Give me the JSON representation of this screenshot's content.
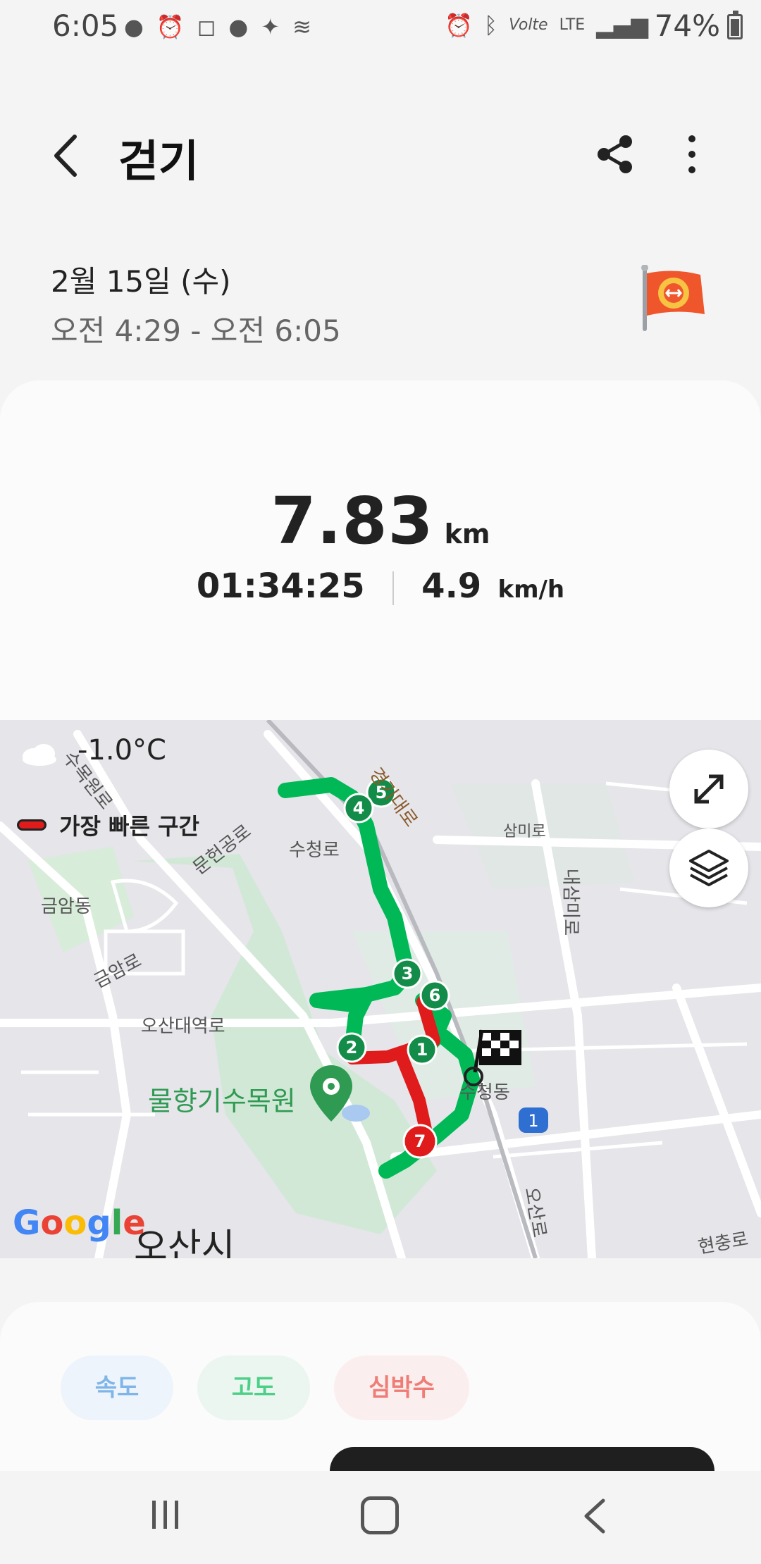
{
  "status_bar": {
    "time": "6:05",
    "battery": "74%",
    "network": "LTE",
    "volte": "Volte"
  },
  "header": {
    "title": "걷기"
  },
  "session": {
    "date": "2월 15일 (수)",
    "time_range": "오전 4:29 - 오전 6:05"
  },
  "summary": {
    "distance": "7.83",
    "distance_unit": "km",
    "duration": "01:34:25",
    "speed": "4.9",
    "speed_unit": "km/h"
  },
  "map": {
    "temperature": "-1.0°C",
    "legend_label": "가장 빠른 구간",
    "labels": {
      "suwonro": "수목원로",
      "munheon": "문헌공로",
      "suchung": "수청로",
      "gyeonggi": "경기대로",
      "sammiro": "삼미로",
      "naesammiro": "내삼미로",
      "geumam_dong": "금암동",
      "geumam_ro": "금암로",
      "osan_daero": "오산대역로",
      "park": "물향기수목원",
      "sucheong_dong": "수청동",
      "osan_ro": "오산로",
      "hyeonchung": "현충로",
      "city": "오산시"
    },
    "google": [
      "G",
      "o",
      "o",
      "g",
      "l",
      "e"
    ],
    "markers": [
      "1",
      "2",
      "3",
      "4",
      "5",
      "6",
      "7"
    ],
    "blue_marker": "1",
    "colors": {
      "route": "#00b956",
      "fastest": "#e01b1b",
      "marker": "#128c48"
    }
  },
  "charts": {
    "tabs": [
      "속도",
      "고도",
      "심박수"
    ]
  },
  "icons": {
    "back": "chevron-left-icon",
    "share": "share-icon",
    "more": "more-vertical-icon",
    "flag": "flag-badge-icon",
    "expand": "expand-icon",
    "layers": "layers-icon"
  }
}
